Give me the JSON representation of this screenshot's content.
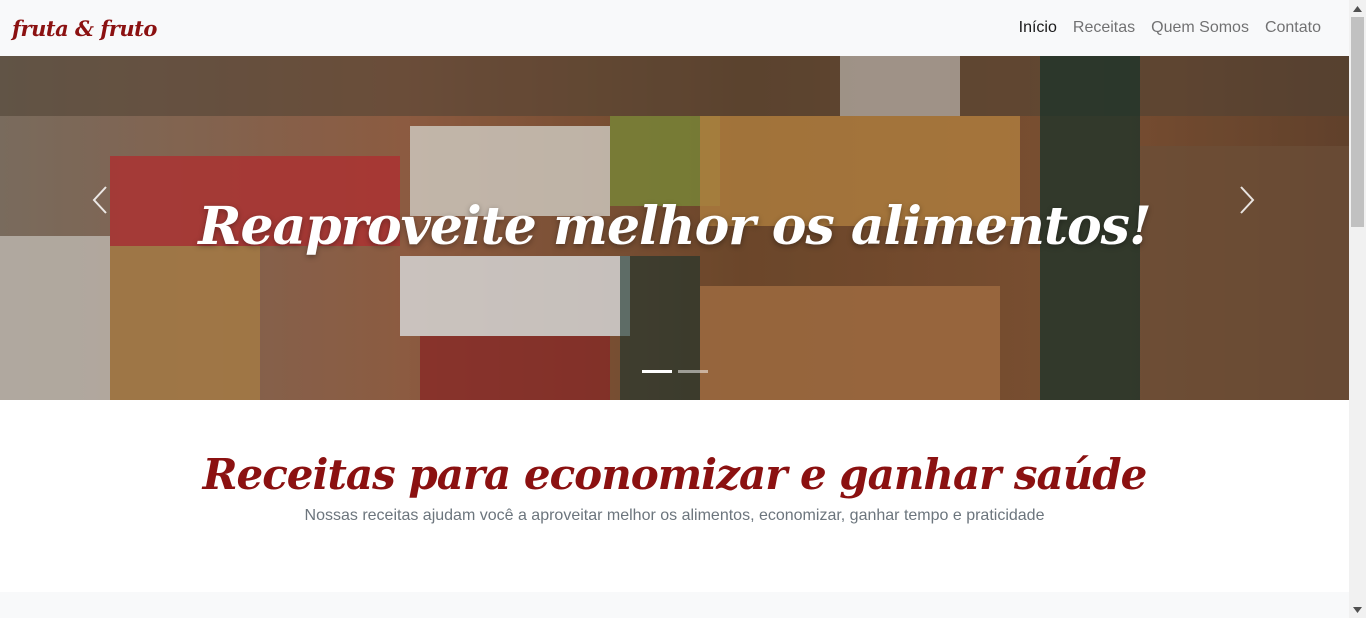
{
  "navbar": {
    "brand": "fruta & fruto",
    "links": [
      {
        "label": "Início",
        "active": true
      },
      {
        "label": "Receitas",
        "active": false
      },
      {
        "label": "Quem Somos",
        "active": false
      },
      {
        "label": "Contato",
        "active": false
      }
    ]
  },
  "carousel": {
    "caption": "Reaproveite melhor os alimentos!",
    "prev_icon": "chevron-left-icon",
    "next_icon": "chevron-right-icon",
    "slide_count": 2,
    "active_slide": 1
  },
  "section": {
    "title": "Receitas para economizar e ganhar saúde",
    "subtitle": "Nossas receitas ajudam você a aproveitar melhor os alimentos, economizar, ganhar tempo e praticidade"
  },
  "colors": {
    "brand": "#8b1111",
    "navbar_bg": "#f8f9fa",
    "muted_text": "#6c757d"
  }
}
